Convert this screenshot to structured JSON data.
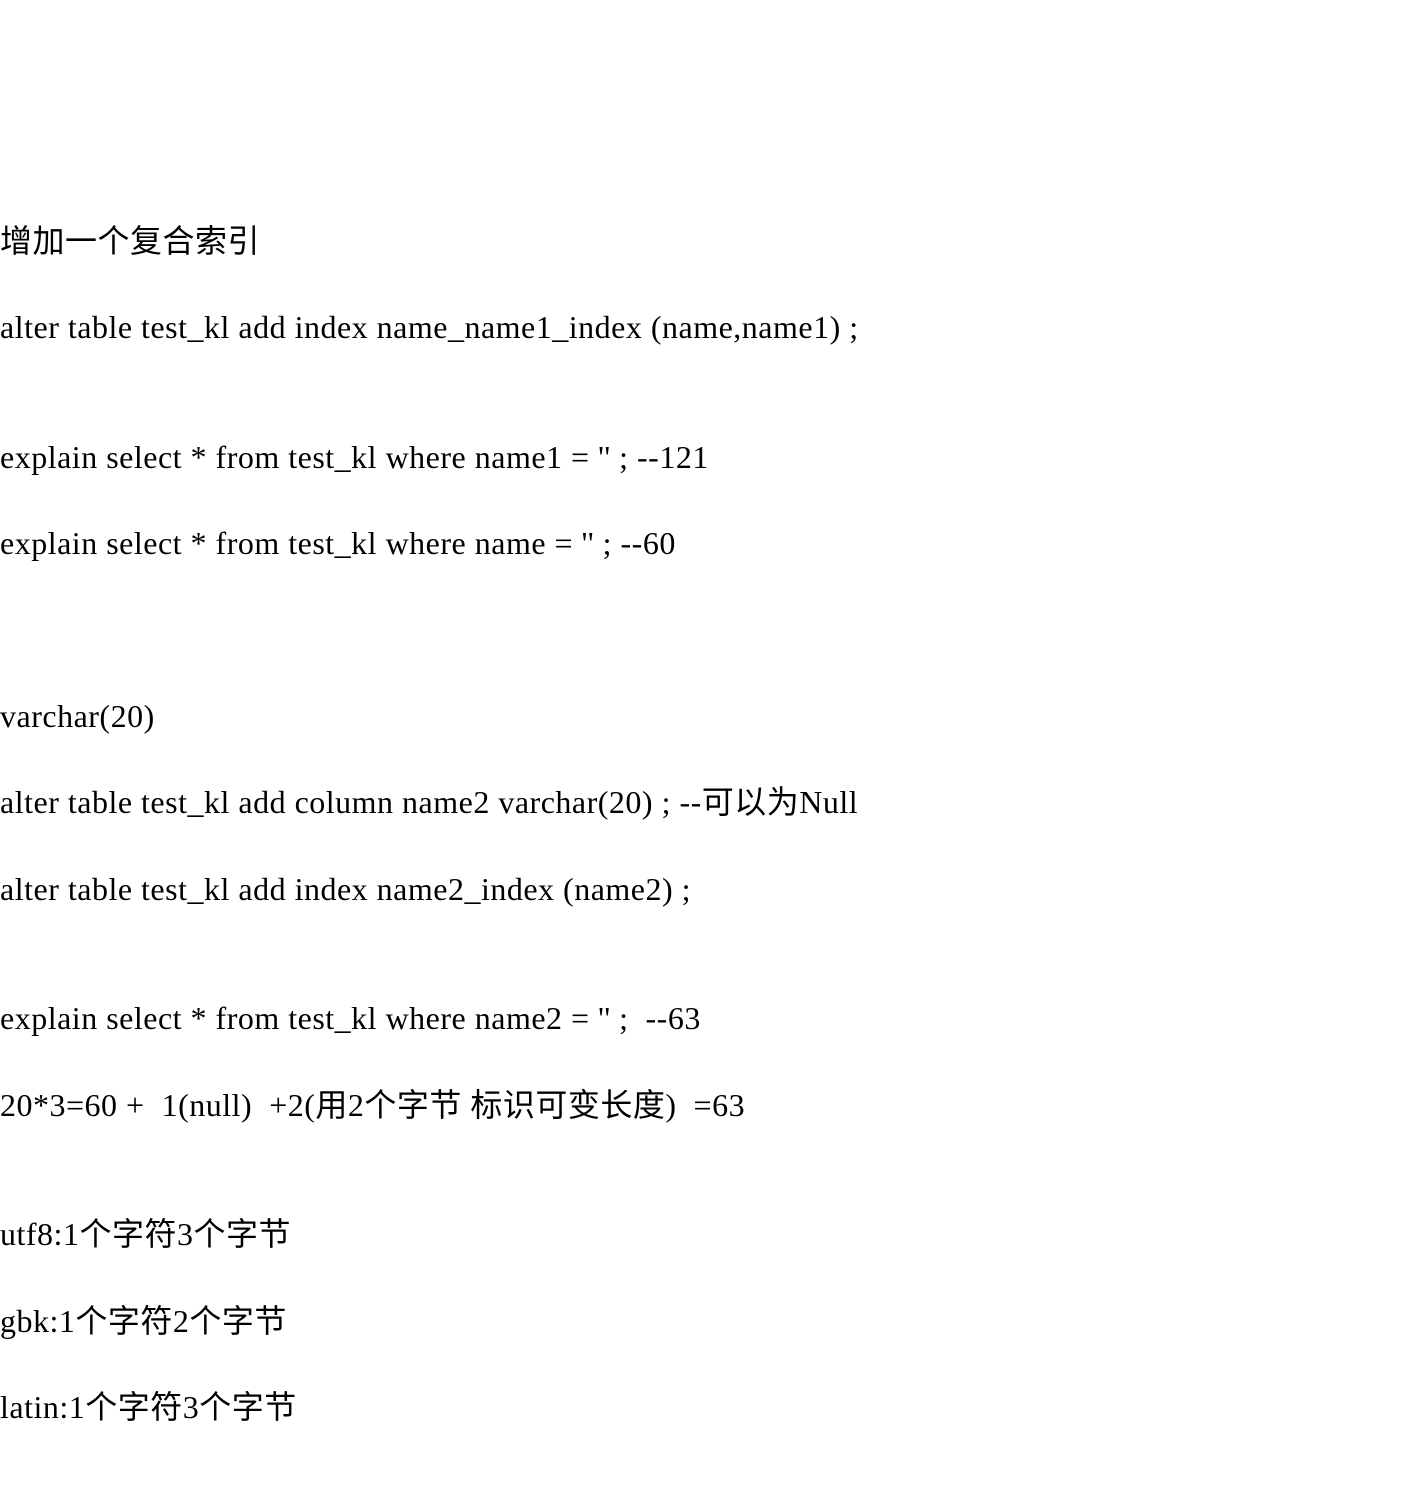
{
  "lines": {
    "l01": "增加一个复合索引",
    "l02": "alter table test_kl add index name_name1_index (name,name1) ;",
    "l03": "",
    "l04": "explain select * from test_kl where name1 = '' ; --121",
    "l05": "explain select * from test_kl where name = '' ; --60",
    "l06": "",
    "l07": "",
    "l08": "varchar(20)",
    "l09": "alter table test_kl add column name2 varchar(20) ; --可以为Null",
    "l10": "alter table test_kl add index name2_index (name2) ;",
    "l11": "",
    "l12": "explain select * from test_kl where name2 = '' ;  --63",
    "l13": "20*3=60 +  1(null)  +2(用2个字节 标识可变长度)  =63",
    "l14": "",
    "l15": "utf8:1个字符3个字节",
    "l16": "gbk:1个字符2个字节",
    "l17": "latin:1个字符3个字节"
  }
}
